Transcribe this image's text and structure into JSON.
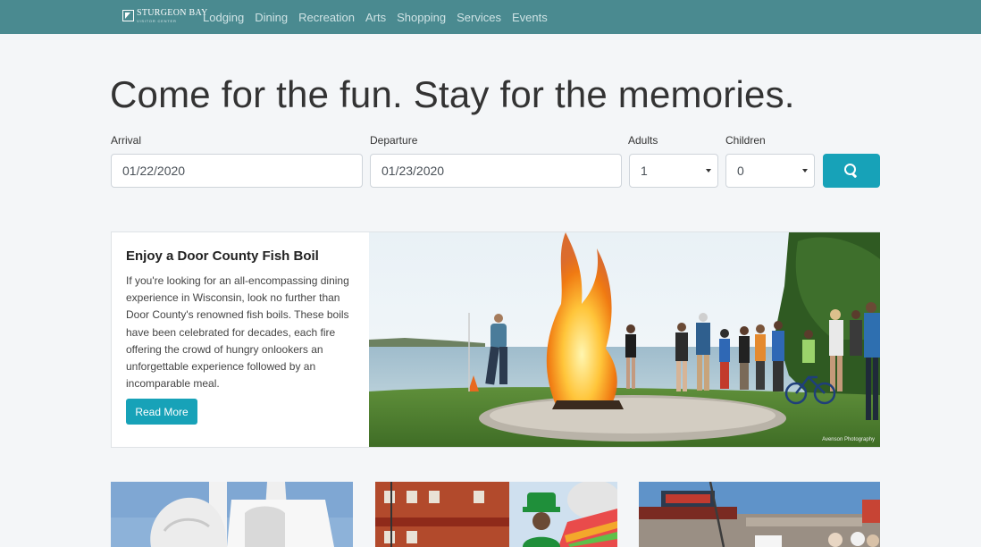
{
  "nav": {
    "brand_name": "STURGEON BAY",
    "brand_sub": "VISITOR CENTER",
    "links": [
      "Lodging",
      "Dining",
      "Recreation",
      "Arts",
      "Shopping",
      "Services",
      "Events"
    ]
  },
  "hero": {
    "title": "Come for the fun. Stay for the memories."
  },
  "search": {
    "arrival_label": "Arrival",
    "arrival_value": "01/22/2020",
    "departure_label": "Departure",
    "departure_value": "01/23/2020",
    "adults_label": "Adults",
    "adults_value": "1",
    "children_label": "Children",
    "children_value": "0",
    "search_icon": "search-icon"
  },
  "feature": {
    "title": "Enjoy a Door County Fish Boil",
    "body": "If you're looking for an all-encompassing dining experience in Wisconsin, look no further than Door County's renowned fish boils. These boils have been celebrated for decades, each fire offering the crowd of hungry onlookers an unforgettable experience followed by an incomparable meal.",
    "button_label": "Read More",
    "photo_credit": "Avenson Photography"
  },
  "colors": {
    "nav_bg": "#4a8a90",
    "accent": "#17a2b8",
    "page_bg": "#f4f6f8"
  }
}
